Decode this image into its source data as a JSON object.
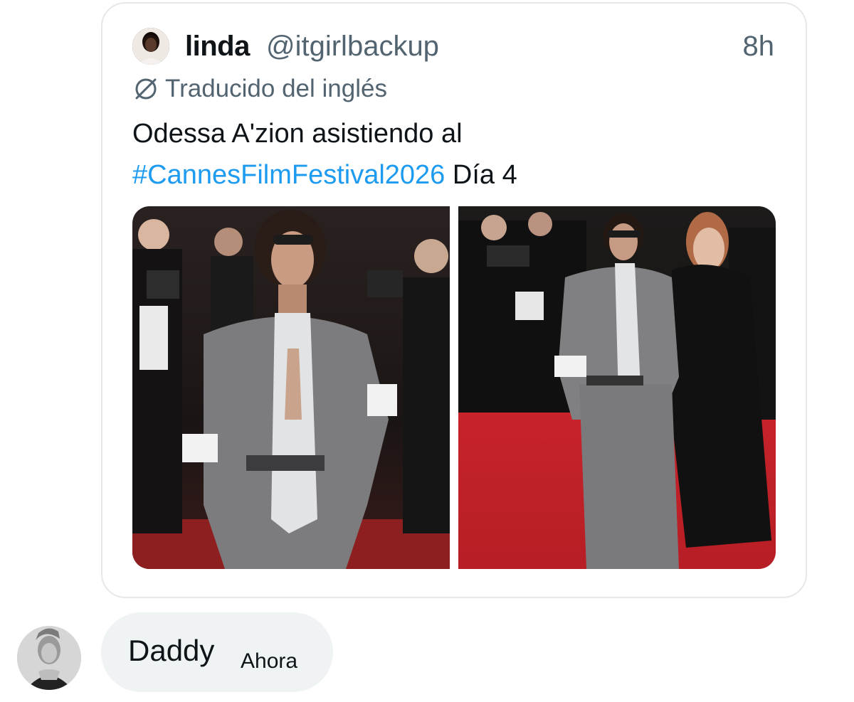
{
  "tweet": {
    "name": "linda",
    "handle": "@itgirlbackup",
    "time": "8h",
    "translated_label": "Traducido del inglés",
    "text_before": "Odessa A'zion asistiendo al",
    "hashtag": "#CannesFilmFestival2026",
    "text_after": " Día 4",
    "media": [
      {
        "alt": "Photo 1"
      },
      {
        "alt": "Photo 2"
      }
    ]
  },
  "reply": {
    "message": "Daddy",
    "time": "Ahora"
  },
  "colors": {
    "link": "#1d9bf0",
    "secondary_text": "#536471",
    "bubble_bg": "#eff3f4",
    "card_border": "#e4e8eb",
    "carpet_red": "#c8232b"
  },
  "icons": [
    "translate-icon",
    "avatar"
  ]
}
